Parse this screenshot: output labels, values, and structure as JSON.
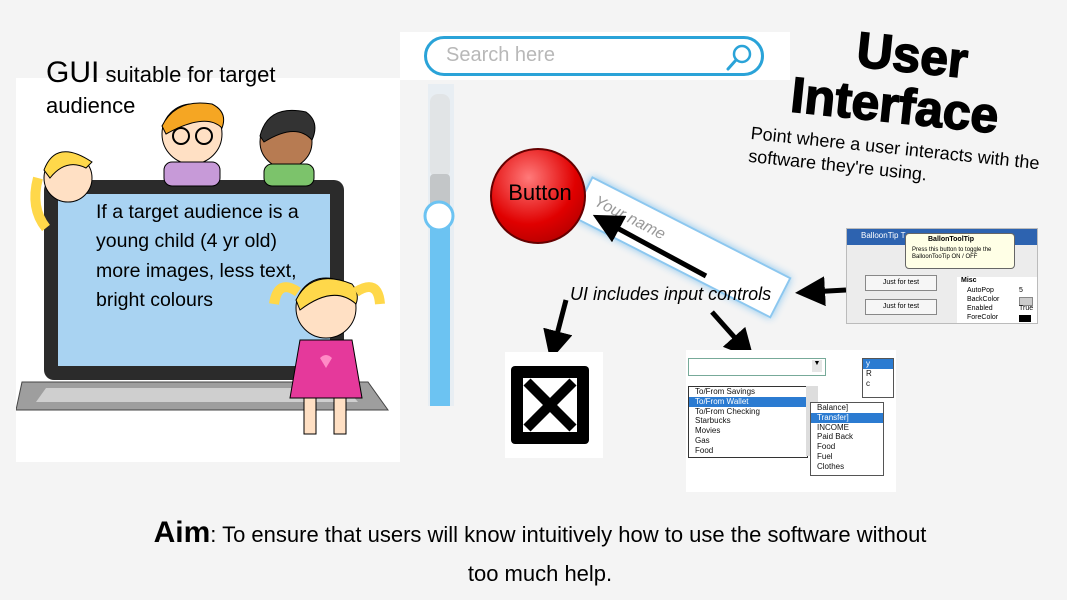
{
  "gui_heading": {
    "big": "GUI",
    "rest": "suitable for target audience"
  },
  "screen_text": "If a target audience is a young child (4 yr old) more images, less text, bright colours",
  "search": {
    "placeholder": "Search here"
  },
  "title": {
    "line1": "User",
    "line2": "Interface"
  },
  "subtitle": "Point where a user interacts with the software they're using.",
  "name_field": {
    "placeholder": "Your name"
  },
  "red_button": {
    "label": "Button"
  },
  "ui_label": "UI includes input controls",
  "dropdown": {
    "items": [
      "To/From Savings",
      "To/From Wallet",
      "To/From Checking",
      "Starbucks",
      "Movies",
      "Gas",
      "Food"
    ],
    "selected": "To/From Wallet",
    "right_items": [
      "Balance]",
      "Transfer]",
      "INCOME",
      "Paid Back",
      "Food",
      "Fuel",
      "Clothes"
    ],
    "mini_items": [
      "y",
      "R",
      "c"
    ]
  },
  "prop_grid": {
    "window_title": "BalloonTip T",
    "balloon_title": "BallonToolTip",
    "balloon_text": "Press this button to toggle the BalloonTooTip ON / OFF",
    "btn1": "Just for test",
    "btn2": "Just for test",
    "section": "Misc",
    "rows": [
      {
        "name": "AutoPop",
        "value": "5"
      },
      {
        "name": "BackColor",
        "value": ""
      },
      {
        "name": "Enabled",
        "value": "True"
      },
      {
        "name": "ForeColor",
        "value": ""
      }
    ]
  },
  "aim": {
    "bold": "Aim",
    "text": ": To ensure that users will know intuitively how to use the software without too much help."
  },
  "colors": {
    "accent_blue": "#2aa3d8",
    "button_red": "#e00000",
    "slider_blue": "#6cc3f2"
  },
  "icons": [
    "magnifier-icon",
    "checkbox-x-icon",
    "arrow-icon"
  ]
}
